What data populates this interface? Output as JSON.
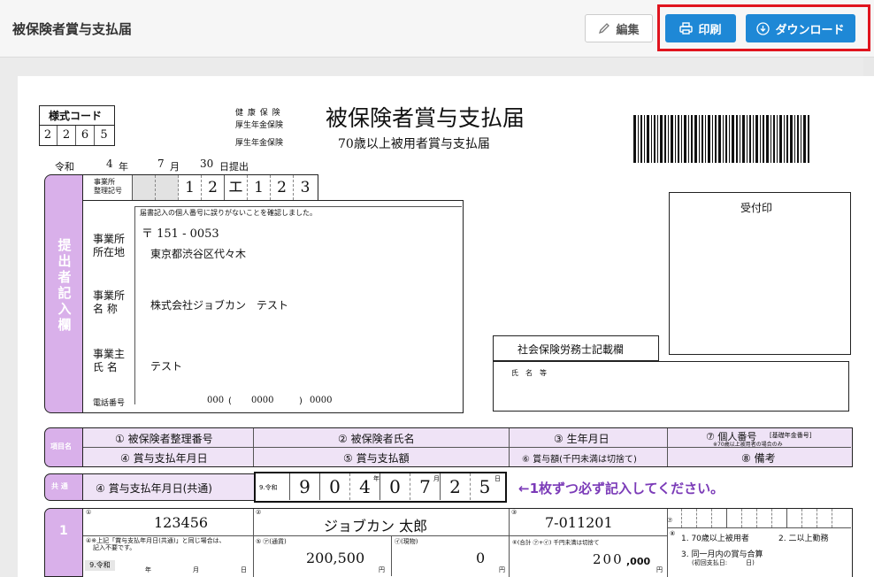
{
  "header": {
    "title": "被保険者賞与支払届",
    "edit_label": "編集",
    "print_label": "印刷",
    "download_label": "ダウンロード"
  },
  "form": {
    "code_label": "様式コード",
    "code_digits": [
      "2",
      "2",
      "6",
      "5"
    ],
    "ins_1": "健 康 保 険",
    "ins_2": "厚生年金保険",
    "ins_3": "厚生年金保険",
    "main_title": "被保険者賞与支払届",
    "sub_title": "70歳以上被用者賞与支払届",
    "date_era": "令和",
    "date_year": "4",
    "date_year_unit": "年",
    "date_month": "7",
    "date_month_unit": "月",
    "date_day": "30",
    "date_suffix": "日提出",
    "office_no_label_1": "事業所",
    "office_no_label_2": "整理記号",
    "office_no_cells": [
      "",
      "",
      "1",
      "2",
      "エ",
      "1",
      "2",
      "3"
    ],
    "side_label": [
      "提",
      "出",
      "者",
      "記",
      "入",
      "欄"
    ],
    "confirm_note": "届書記入の個人番号に誤りがないことを確認しました。",
    "addr_label_1": "事業所",
    "addr_label_2": "所在地",
    "postal": "〒 151 - 0053",
    "address": "東京都渋谷区代々木",
    "name_label_1": "事業所",
    "name_label_2": "名 称",
    "company": "株式会社ジョブカン　テスト",
    "owner_label_1": "事業主",
    "owner_label_2": "氏 名",
    "owner": "テスト",
    "tel_label": "電話番号",
    "tel_1": "000",
    "tel_2": "0000",
    "tel_3": "0000",
    "receipt_label": "受付印",
    "sharoushi_label": "社会保険労務士記載欄",
    "sharoushi_name_label": "氏　名　等",
    "items_label": "項目名",
    "item_1": "① 被保険者整理番号",
    "item_2": "② 被保険者氏名",
    "item_3": "③ 生年月日",
    "item_7": "⑦ 個人番号",
    "item_7_note_1": "[基礎年金番号]",
    "item_7_note_2": "※70歳以上被用者の場合のみ",
    "item_4": "④ 賞与支払年月日",
    "item_5": "⑤ 賞与支払額",
    "item_6": "⑥ 賞与額(千円未満は切捨て)",
    "item_8": "⑧ 備考",
    "common_label": "共 通",
    "common_title": "④ 賞与支払年月日(共通)",
    "common_era": "9.令和",
    "common_digits": [
      "9",
      "0",
      "4",
      "0",
      "7",
      "2",
      "5"
    ],
    "common_units": [
      "年",
      "月",
      "日"
    ],
    "instruction": "←1枚ずつ必ず記入してください。",
    "row_no": "1",
    "emp_no": "123456",
    "emp_name": "ジョブカン 太郎",
    "birth": "7-011201",
    "note_4a": "④※上記「賞与支払年月日(共通)」と同じ場合は、",
    "note_4b": "記入不要です。",
    "era_small": "9.令和",
    "unit_year": "年",
    "unit_month": "月",
    "unit_day": "日",
    "cash_label": "(通貨)",
    "cash": "200,500",
    "goods_label": "(現物)",
    "goods": "0",
    "yen": "円",
    "total_label": "⑥(合計 ㋐+㋑) 千円未満は切捨て",
    "total_main": "200",
    "total_sub": ",000",
    "biko_1": "1. 70歳以上被用者",
    "biko_2": "2. 二以上勤務",
    "biko_3": "3. 同一月内の賞与合算",
    "biko_4": "(初回支払日:　　　日)"
  }
}
